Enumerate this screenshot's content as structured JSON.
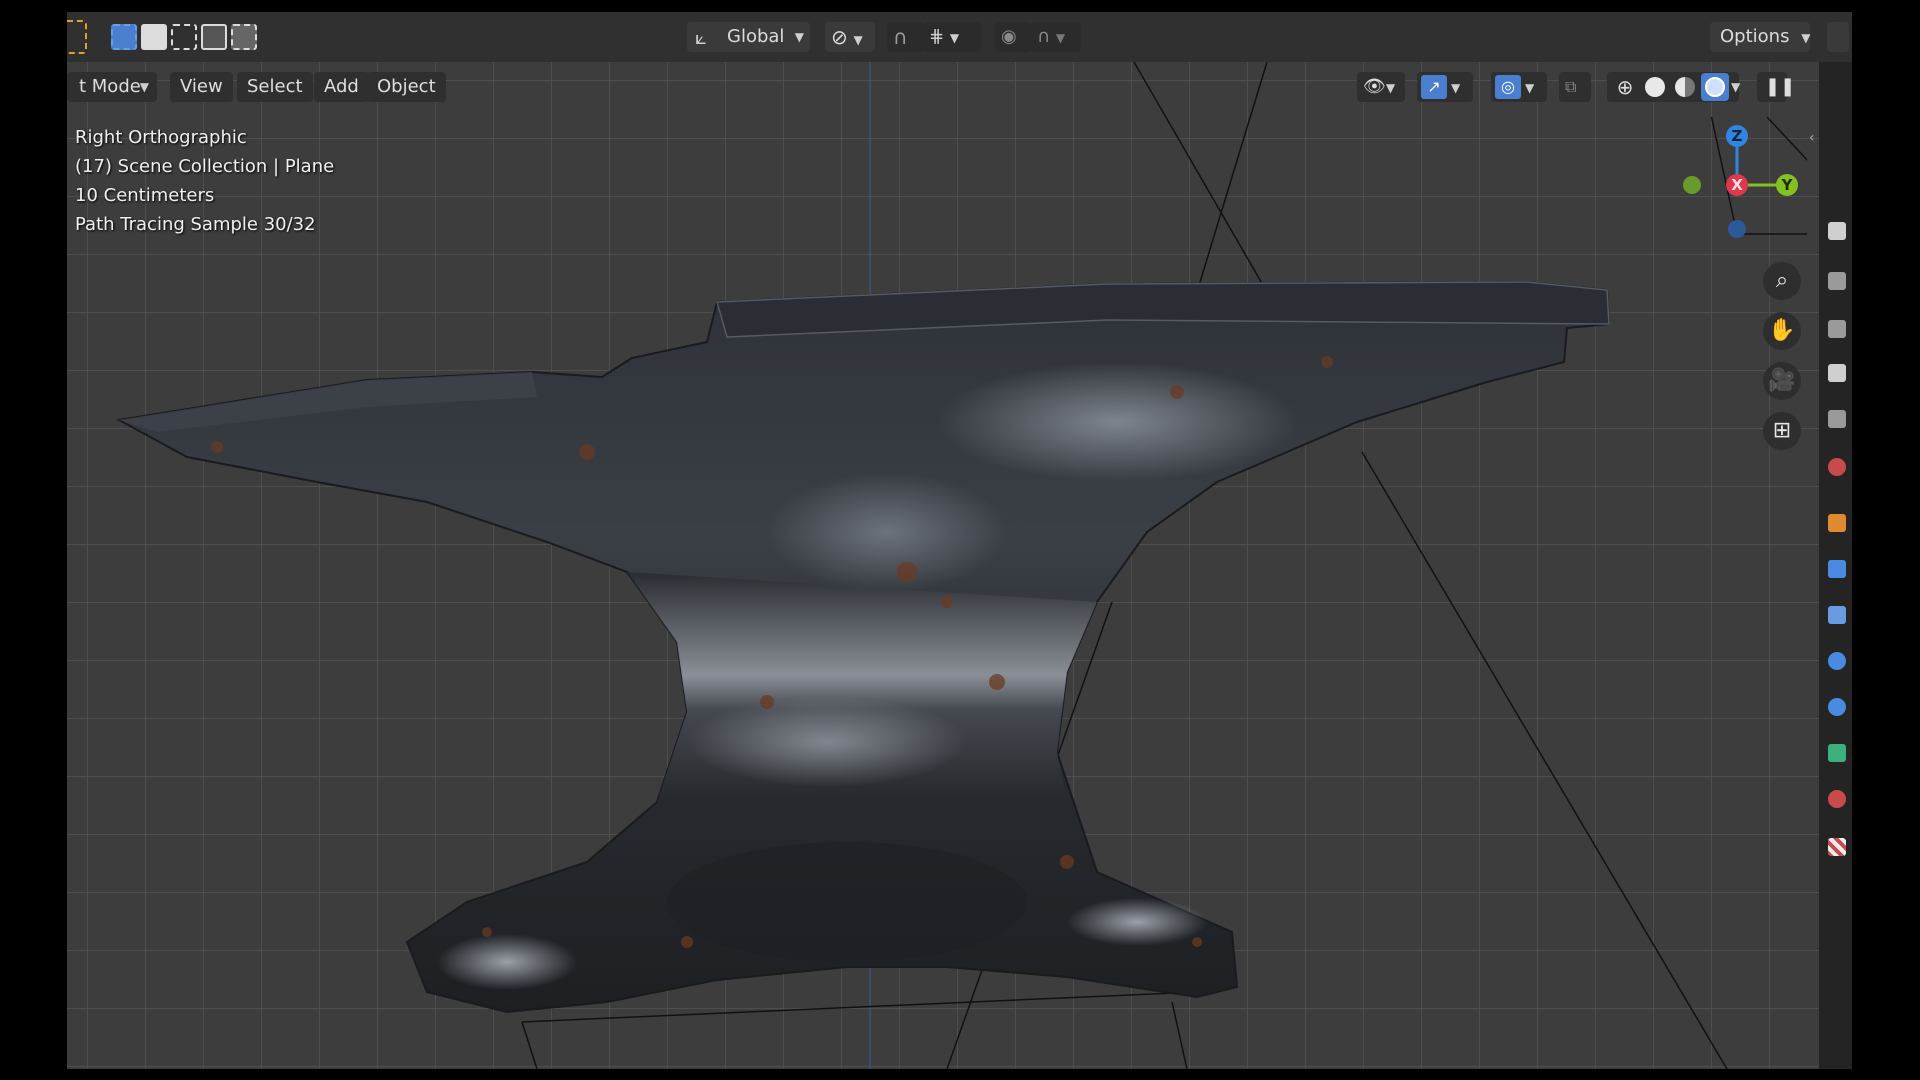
{
  "header": {
    "transform_orientation": "Global",
    "options_label": "Options"
  },
  "viewport_header": {
    "mode_label": "t Mode",
    "menus": [
      "View",
      "Select",
      "Add",
      "Object"
    ]
  },
  "overlay": {
    "view_name": "Right Orthographic",
    "collection": "(17) Scene Collection | Plane",
    "grid_scale": "10 Centimeters",
    "render_status": "Path Tracing Sample 30/32"
  },
  "gizmo": {
    "z_label": "Z",
    "x_label": "X",
    "y_label": "Y",
    "colors": {
      "x": "#e0384b",
      "y": "#83c220",
      "z": "#2e86e0"
    }
  },
  "icons": {
    "select_box": "select-box-icon",
    "zoom": "zoom-icon",
    "pan": "hand-pan-icon",
    "camera": "camera-icon",
    "grid": "grid-icon"
  }
}
